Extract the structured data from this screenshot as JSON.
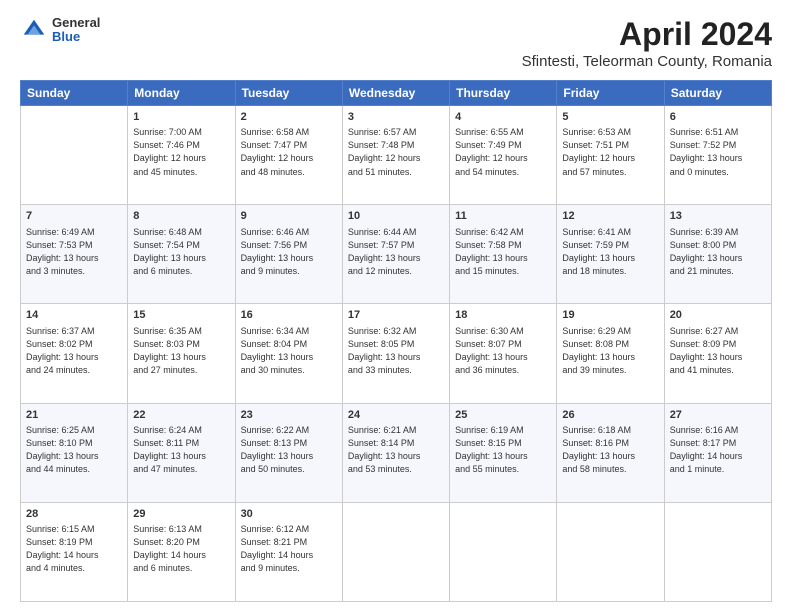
{
  "logo": {
    "general": "General",
    "blue": "Blue"
  },
  "title": "April 2024",
  "subtitle": "Sfintesti, Teleorman County, Romania",
  "headers": [
    "Sunday",
    "Monday",
    "Tuesday",
    "Wednesday",
    "Thursday",
    "Friday",
    "Saturday"
  ],
  "weeks": [
    [
      {
        "day": "",
        "content": ""
      },
      {
        "day": "1",
        "content": "Sunrise: 7:00 AM\nSunset: 7:46 PM\nDaylight: 12 hours\nand 45 minutes."
      },
      {
        "day": "2",
        "content": "Sunrise: 6:58 AM\nSunset: 7:47 PM\nDaylight: 12 hours\nand 48 minutes."
      },
      {
        "day": "3",
        "content": "Sunrise: 6:57 AM\nSunset: 7:48 PM\nDaylight: 12 hours\nand 51 minutes."
      },
      {
        "day": "4",
        "content": "Sunrise: 6:55 AM\nSunset: 7:49 PM\nDaylight: 12 hours\nand 54 minutes."
      },
      {
        "day": "5",
        "content": "Sunrise: 6:53 AM\nSunset: 7:51 PM\nDaylight: 12 hours\nand 57 minutes."
      },
      {
        "day": "6",
        "content": "Sunrise: 6:51 AM\nSunset: 7:52 PM\nDaylight: 13 hours\nand 0 minutes."
      }
    ],
    [
      {
        "day": "7",
        "content": "Sunrise: 6:49 AM\nSunset: 7:53 PM\nDaylight: 13 hours\nand 3 minutes."
      },
      {
        "day": "8",
        "content": "Sunrise: 6:48 AM\nSunset: 7:54 PM\nDaylight: 13 hours\nand 6 minutes."
      },
      {
        "day": "9",
        "content": "Sunrise: 6:46 AM\nSunset: 7:56 PM\nDaylight: 13 hours\nand 9 minutes."
      },
      {
        "day": "10",
        "content": "Sunrise: 6:44 AM\nSunset: 7:57 PM\nDaylight: 13 hours\nand 12 minutes."
      },
      {
        "day": "11",
        "content": "Sunrise: 6:42 AM\nSunset: 7:58 PM\nDaylight: 13 hours\nand 15 minutes."
      },
      {
        "day": "12",
        "content": "Sunrise: 6:41 AM\nSunset: 7:59 PM\nDaylight: 13 hours\nand 18 minutes."
      },
      {
        "day": "13",
        "content": "Sunrise: 6:39 AM\nSunset: 8:00 PM\nDaylight: 13 hours\nand 21 minutes."
      }
    ],
    [
      {
        "day": "14",
        "content": "Sunrise: 6:37 AM\nSunset: 8:02 PM\nDaylight: 13 hours\nand 24 minutes."
      },
      {
        "day": "15",
        "content": "Sunrise: 6:35 AM\nSunset: 8:03 PM\nDaylight: 13 hours\nand 27 minutes."
      },
      {
        "day": "16",
        "content": "Sunrise: 6:34 AM\nSunset: 8:04 PM\nDaylight: 13 hours\nand 30 minutes."
      },
      {
        "day": "17",
        "content": "Sunrise: 6:32 AM\nSunset: 8:05 PM\nDaylight: 13 hours\nand 33 minutes."
      },
      {
        "day": "18",
        "content": "Sunrise: 6:30 AM\nSunset: 8:07 PM\nDaylight: 13 hours\nand 36 minutes."
      },
      {
        "day": "19",
        "content": "Sunrise: 6:29 AM\nSunset: 8:08 PM\nDaylight: 13 hours\nand 39 minutes."
      },
      {
        "day": "20",
        "content": "Sunrise: 6:27 AM\nSunset: 8:09 PM\nDaylight: 13 hours\nand 41 minutes."
      }
    ],
    [
      {
        "day": "21",
        "content": "Sunrise: 6:25 AM\nSunset: 8:10 PM\nDaylight: 13 hours\nand 44 minutes."
      },
      {
        "day": "22",
        "content": "Sunrise: 6:24 AM\nSunset: 8:11 PM\nDaylight: 13 hours\nand 47 minutes."
      },
      {
        "day": "23",
        "content": "Sunrise: 6:22 AM\nSunset: 8:13 PM\nDaylight: 13 hours\nand 50 minutes."
      },
      {
        "day": "24",
        "content": "Sunrise: 6:21 AM\nSunset: 8:14 PM\nDaylight: 13 hours\nand 53 minutes."
      },
      {
        "day": "25",
        "content": "Sunrise: 6:19 AM\nSunset: 8:15 PM\nDaylight: 13 hours\nand 55 minutes."
      },
      {
        "day": "26",
        "content": "Sunrise: 6:18 AM\nSunset: 8:16 PM\nDaylight: 13 hours\nand 58 minutes."
      },
      {
        "day": "27",
        "content": "Sunrise: 6:16 AM\nSunset: 8:17 PM\nDaylight: 14 hours\nand 1 minute."
      }
    ],
    [
      {
        "day": "28",
        "content": "Sunrise: 6:15 AM\nSunset: 8:19 PM\nDaylight: 14 hours\nand 4 minutes."
      },
      {
        "day": "29",
        "content": "Sunrise: 6:13 AM\nSunset: 8:20 PM\nDaylight: 14 hours\nand 6 minutes."
      },
      {
        "day": "30",
        "content": "Sunrise: 6:12 AM\nSunset: 8:21 PM\nDaylight: 14 hours\nand 9 minutes."
      },
      {
        "day": "",
        "content": ""
      },
      {
        "day": "",
        "content": ""
      },
      {
        "day": "",
        "content": ""
      },
      {
        "day": "",
        "content": ""
      }
    ]
  ]
}
